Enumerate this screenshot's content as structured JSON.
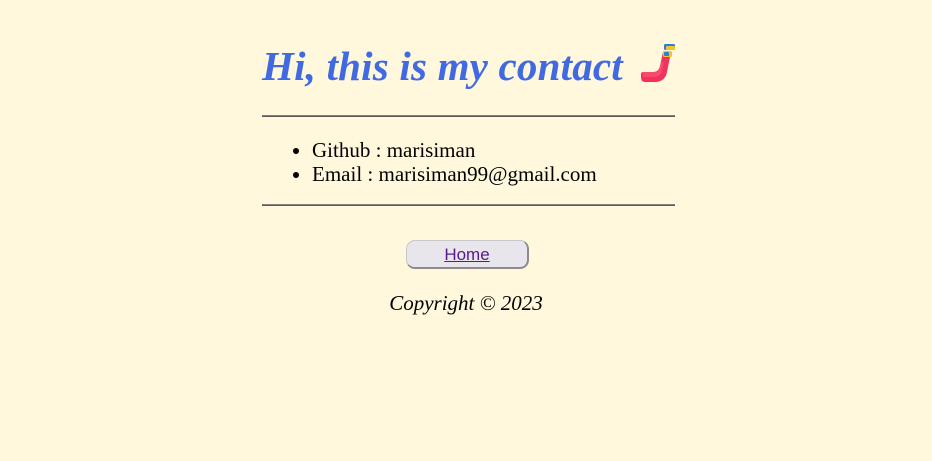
{
  "header": {
    "title": "Hi, this is my contact",
    "icon": "telephone-receiver-icon"
  },
  "contacts": [
    {
      "label": "Github",
      "separator": ":",
      "value": "marisiman"
    },
    {
      "label": "Email",
      "separator": ":",
      "value": "marisiman99@gmail.com"
    }
  ],
  "nav": {
    "home_label": "Home"
  },
  "footer": {
    "copyright": "Copyright © 2023"
  },
  "colors": {
    "background": "#fff8dc",
    "title": "#4169e1",
    "visited_link": "#551a8b"
  }
}
